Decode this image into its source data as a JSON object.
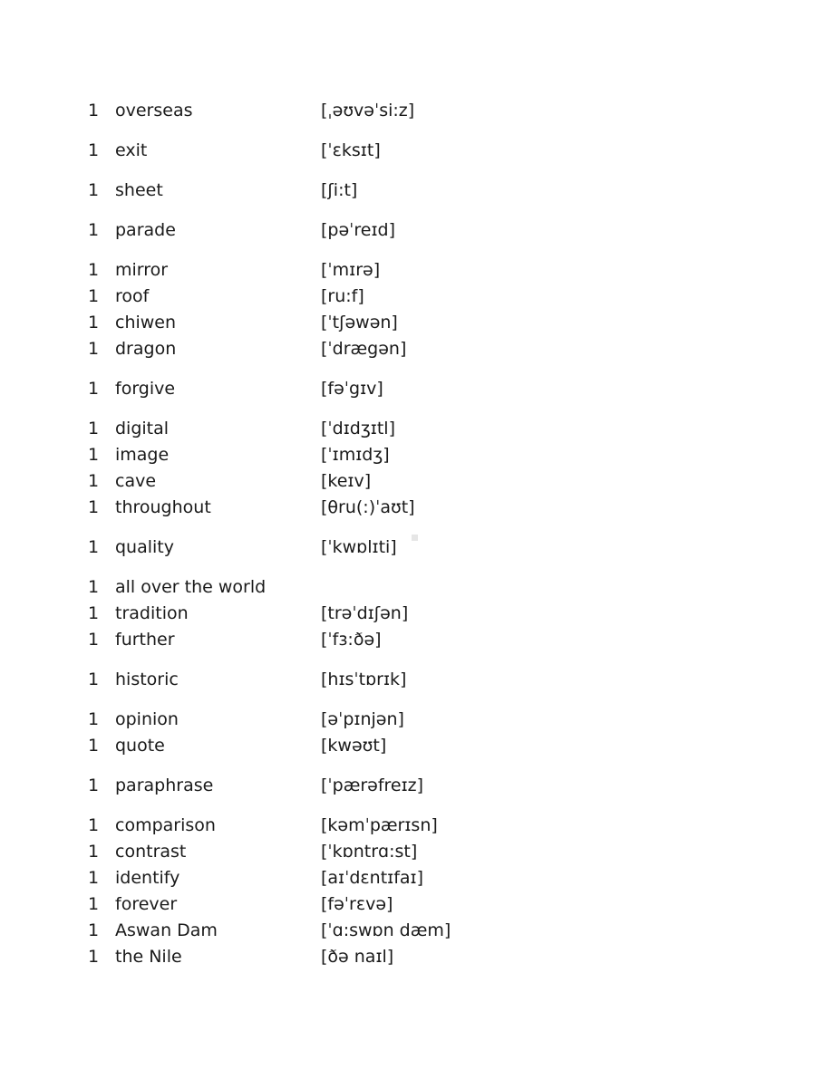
{
  "page": {
    "background_color": "#ffffff",
    "text_color": "#1a1a1a",
    "artifact_color": "#e6e6e6"
  },
  "word_list": {
    "groups": [
      {
        "rows": [
          {
            "count": "1",
            "word": "overseas",
            "phonetic": "[ˌəʊvəˈsi:z]"
          }
        ]
      },
      {
        "rows": [
          {
            "count": "1",
            "word": "exit",
            "phonetic": "[ˈɛksɪt]"
          }
        ]
      },
      {
        "rows": [
          {
            "count": "1",
            "word": "sheet",
            "phonetic": "[ʃi:t]"
          }
        ]
      },
      {
        "rows": [
          {
            "count": "1",
            "word": "parade",
            "phonetic": "[pəˈreɪd]"
          }
        ]
      },
      {
        "rows": [
          {
            "count": "1",
            "word": "mirror",
            "phonetic": "[ˈmɪrə]"
          },
          {
            "count": "1",
            "word": "roof",
            "phonetic": "[ru:f]"
          },
          {
            "count": "1",
            "word": "chiwen",
            "phonetic": "[ˈtʃəwən]"
          },
          {
            "count": "1",
            "word": "dragon",
            "phonetic": "[ˈdrægən]"
          }
        ]
      },
      {
        "rows": [
          {
            "count": "1",
            "word": "forgive",
            "phonetic": "[fəˈgɪv]"
          }
        ]
      },
      {
        "rows": [
          {
            "count": "1",
            "word": "digital",
            "phonetic": "[ˈdɪdʒɪtl]"
          },
          {
            "count": "1",
            "word": "image",
            "phonetic": "[ˈɪmɪdʒ]"
          },
          {
            "count": "1",
            "word": "cave",
            "phonetic": "[keɪv]"
          },
          {
            "count": "1",
            "word": "throughout",
            "phonetic": "[θru(:)ˈaʊt]"
          }
        ]
      },
      {
        "rows": [
          {
            "count": "1",
            "word": "quality",
            "phonetic": "[ˈkwɒlɪti]"
          }
        ]
      },
      {
        "rows": [
          {
            "count": "1",
            "word": "all over the world",
            "phonetic": ""
          },
          {
            "count": "1",
            "word": "tradition",
            "phonetic": "[trəˈdɪʃən]"
          },
          {
            "count": "1",
            "word": "further",
            "phonetic": "[ˈfɜ:ðə]"
          }
        ]
      },
      {
        "rows": [
          {
            "count": "1",
            "word": "historic",
            "phonetic": "[hɪsˈtɒrɪk]"
          }
        ]
      },
      {
        "rows": [
          {
            "count": "1",
            "word": "opinion",
            "phonetic": "[əˈpɪnjən]"
          },
          {
            "count": "1",
            "word": "quote",
            "phonetic": "[kwəʊt]"
          }
        ]
      },
      {
        "rows": [
          {
            "count": "1",
            "word": "paraphrase",
            "phonetic": "[ˈpærəfreɪz]"
          }
        ]
      },
      {
        "rows": [
          {
            "count": "1",
            "word": "comparison",
            "phonetic": "[kəmˈpærɪsn]"
          },
          {
            "count": "1",
            "word": "contrast",
            "phonetic": "[ˈkɒntrɑ:st]"
          },
          {
            "count": "1",
            "word": "identify",
            "phonetic": "[aɪˈdɛntɪfaɪ]"
          },
          {
            "count": "1",
            "word": "forever",
            "phonetic": "[fəˈrɛvə]"
          },
          {
            "count": "1",
            "word": "Aswan Dam",
            "phonetic": "[ˈɑ:swɒn dæm]"
          },
          {
            "count": "1",
            "word": "the Nile",
            "phonetic": "[ðə naɪl]"
          }
        ]
      }
    ]
  }
}
